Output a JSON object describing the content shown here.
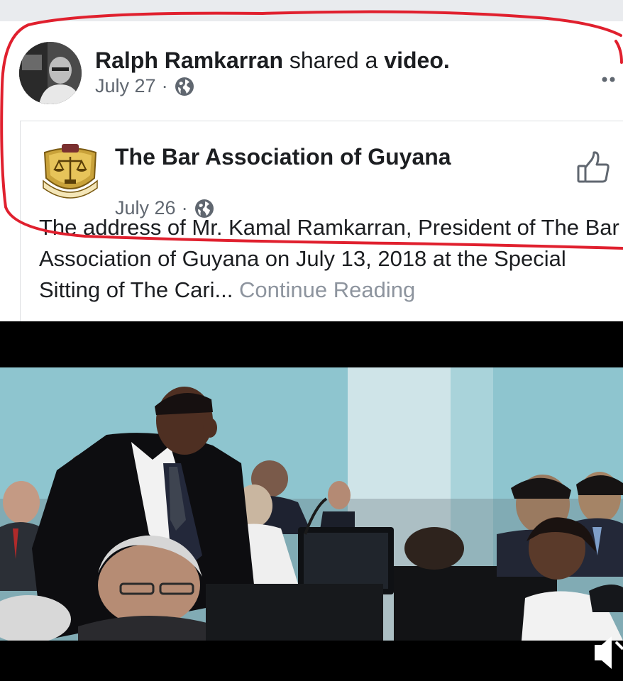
{
  "post": {
    "sharer_name": "Ralph Ramkarran",
    "action_verb": "shared a",
    "action_object": "video.",
    "date": "July 27",
    "separator": "·",
    "privacy_icon": "globe-icon",
    "menu_icon": "more-options-icon"
  },
  "shared_post": {
    "page_name": "The Bar Association of Guyana",
    "date": "July 26",
    "separator": "·",
    "privacy_icon": "globe-icon",
    "logo_text": "GUYANA BAR ASSOCIATION",
    "like_icon": "thumbs-up-icon",
    "body_text": "The address of Mr. Kamal Ramkarran, President of The Bar Association of Guyana on July 13, 2018 at the Special Sitting of The Cari...",
    "continue_label": "Continue Reading"
  },
  "video": {
    "sound_icon": "speaker-muted-icon"
  },
  "colors": {
    "annotation_red": "#e0202e",
    "meta_gray": "#606770",
    "link_gray": "#8d949e",
    "wall_blue": "#8ec5cf"
  }
}
